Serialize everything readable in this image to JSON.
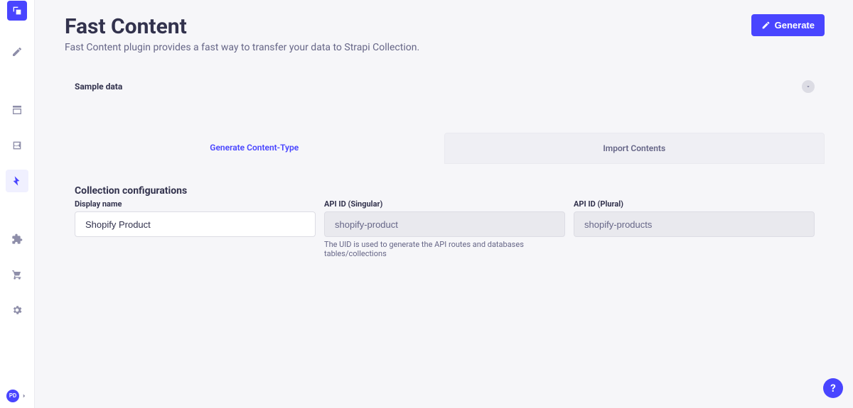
{
  "header": {
    "title": "Fast Content",
    "subtitle": "Fast Content plugin provides a fast way to transfer your data to Strapi Collection.",
    "generate_label": "Generate"
  },
  "sample": {
    "label": "Sample data"
  },
  "tabs": {
    "generate": "Generate Content-Type",
    "import": "Import Contents"
  },
  "section": {
    "title": "Collection configurations",
    "display_name": {
      "label": "Display name",
      "value": "Shopify Product"
    },
    "api_singular": {
      "label": "API ID (Singular)",
      "value": "shopify-product",
      "hint": "The UID is used to generate the API routes and databases tables/collections"
    },
    "api_plural": {
      "label": "API ID (Plural)",
      "value": "shopify-products"
    }
  },
  "sidebar": {
    "avatar": "PD"
  },
  "help": {
    "label": "?"
  }
}
